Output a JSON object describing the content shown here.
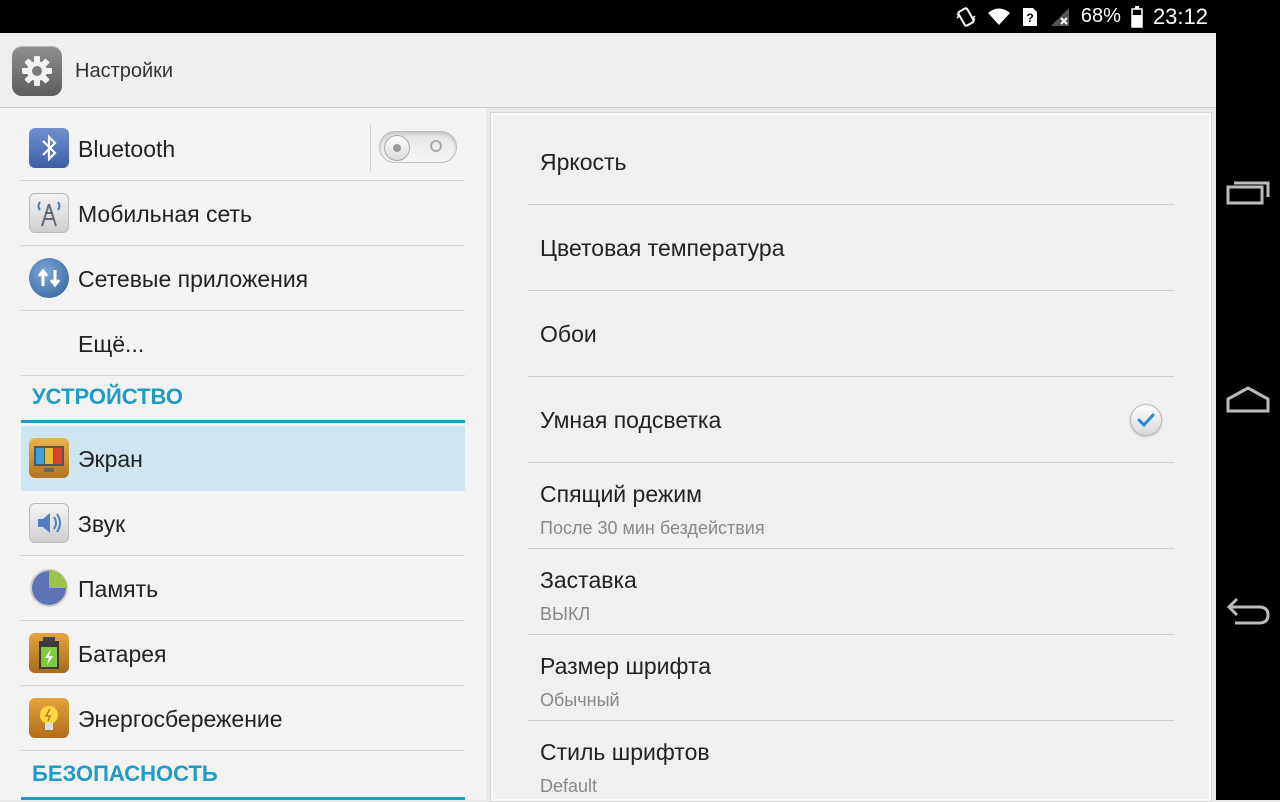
{
  "status_bar": {
    "battery": "68%",
    "time": "23:12",
    "icons": [
      "vibrate-icon",
      "wifi-icon",
      "sim-unknown-icon",
      "no-signal-icon",
      "battery-icon"
    ]
  },
  "action_bar": {
    "title": "Настройки",
    "icon": "settings-gear-icon"
  },
  "sidebar": {
    "items": [
      {
        "label": "Bluetooth",
        "icon": "bluetooth-icon",
        "toggle": "off"
      },
      {
        "label": "Мобильная сеть",
        "icon": "mobile-network-icon"
      },
      {
        "label": "Сетевые приложения",
        "icon": "network-apps-icon"
      },
      {
        "label": "Ещё..."
      }
    ],
    "section_device": "УСТРОЙСТВО",
    "device_items": [
      {
        "label": "Экран",
        "icon": "display-icon",
        "selected": true
      },
      {
        "label": "Звук",
        "icon": "sound-icon"
      },
      {
        "label": "Память",
        "icon": "storage-icon"
      },
      {
        "label": "Батарея",
        "icon": "battery-settings-icon"
      },
      {
        "label": "Энергосбережение",
        "icon": "power-saving-icon"
      }
    ],
    "section_security": "БЕЗОПАСНОСТЬ"
  },
  "display_settings": [
    {
      "title": "Яркость"
    },
    {
      "title": "Цветовая температура"
    },
    {
      "title": "Обои"
    },
    {
      "title": "Умная подсветка",
      "checked": true
    },
    {
      "title": "Спящий режим",
      "summary": "После 30 мин бездействия"
    },
    {
      "title": "Заставка",
      "summary": "ВЫКЛ"
    },
    {
      "title": "Размер шрифта",
      "summary": "Обычный"
    },
    {
      "title": "Стиль шрифтов",
      "summary": "Default"
    }
  ],
  "colors": {
    "accent": "#1f9bc6",
    "selected_bg": "#cde6f0"
  }
}
